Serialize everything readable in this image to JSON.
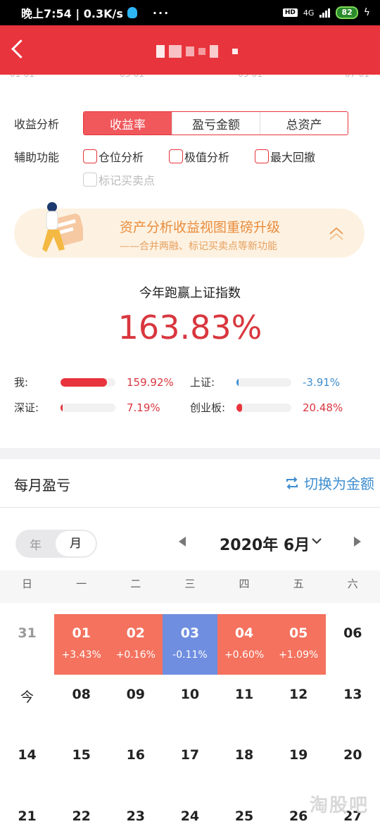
{
  "status_bar": {
    "time": "晚上7:54 | 0.3K/s",
    "dots": "···",
    "hd": "HD",
    "network": "4G",
    "battery": "82"
  },
  "analysis": {
    "label": "收益分析",
    "tabs": [
      "收益率",
      "盈亏金额",
      "总资产"
    ]
  },
  "aux": {
    "label": "辅助功能",
    "options": [
      "仓位分析",
      "极值分析",
      "最大回撤"
    ],
    "mark_points": "标记买卖点"
  },
  "banner": {
    "title": "资产分析收益视图重磅升级",
    "subtitle": "——合并两融、标记买卖点等新功能"
  },
  "benchmark": {
    "title": "今年跑赢上证指数",
    "value": "163.83%"
  },
  "comparisons": [
    {
      "label": "我:",
      "value": "159.92%",
      "percent": 159.92,
      "color": "#e8343c"
    },
    {
      "label": "上证:",
      "value": "-3.91%",
      "percent": -3.91,
      "color": "#3e8ed0"
    },
    {
      "label": "深证:",
      "value": "7.19%",
      "percent": 7.19,
      "color": "#e8343c"
    },
    {
      "label": "创业板:",
      "value": "20.48%",
      "percent": 20.48,
      "color": "#e8343c"
    }
  ],
  "monthly": {
    "title": "每月盈亏",
    "switch_label": "切换为金额",
    "toggle": [
      "年",
      "月"
    ],
    "month": "2020年 6月",
    "weekdays": [
      "日",
      "一",
      "二",
      "三",
      "四",
      "五",
      "六"
    ],
    "days": [
      {
        "d": "31",
        "kind": "gray"
      },
      {
        "d": "01",
        "chg": "+3.43%",
        "kind": "up"
      },
      {
        "d": "02",
        "chg": "+0.16%",
        "kind": "up"
      },
      {
        "d": "03",
        "chg": "-0.11%",
        "kind": "down"
      },
      {
        "d": "04",
        "chg": "+0.60%",
        "kind": "up"
      },
      {
        "d": "05",
        "chg": "+1.09%",
        "kind": "up"
      },
      {
        "d": "06"
      },
      {
        "d": "今",
        "kind": "today"
      },
      {
        "d": "08"
      },
      {
        "d": "09"
      },
      {
        "d": "10"
      },
      {
        "d": "11"
      },
      {
        "d": "12"
      },
      {
        "d": "13"
      },
      {
        "d": "14"
      },
      {
        "d": "15"
      },
      {
        "d": "16"
      },
      {
        "d": "17"
      },
      {
        "d": "18"
      },
      {
        "d": "19"
      },
      {
        "d": "20"
      },
      {
        "d": "21"
      },
      {
        "d": "22"
      },
      {
        "d": "23"
      },
      {
        "d": "24"
      },
      {
        "d": "25"
      },
      {
        "d": "26"
      },
      {
        "d": "27"
      }
    ]
  },
  "watermark": "淘股吧"
}
